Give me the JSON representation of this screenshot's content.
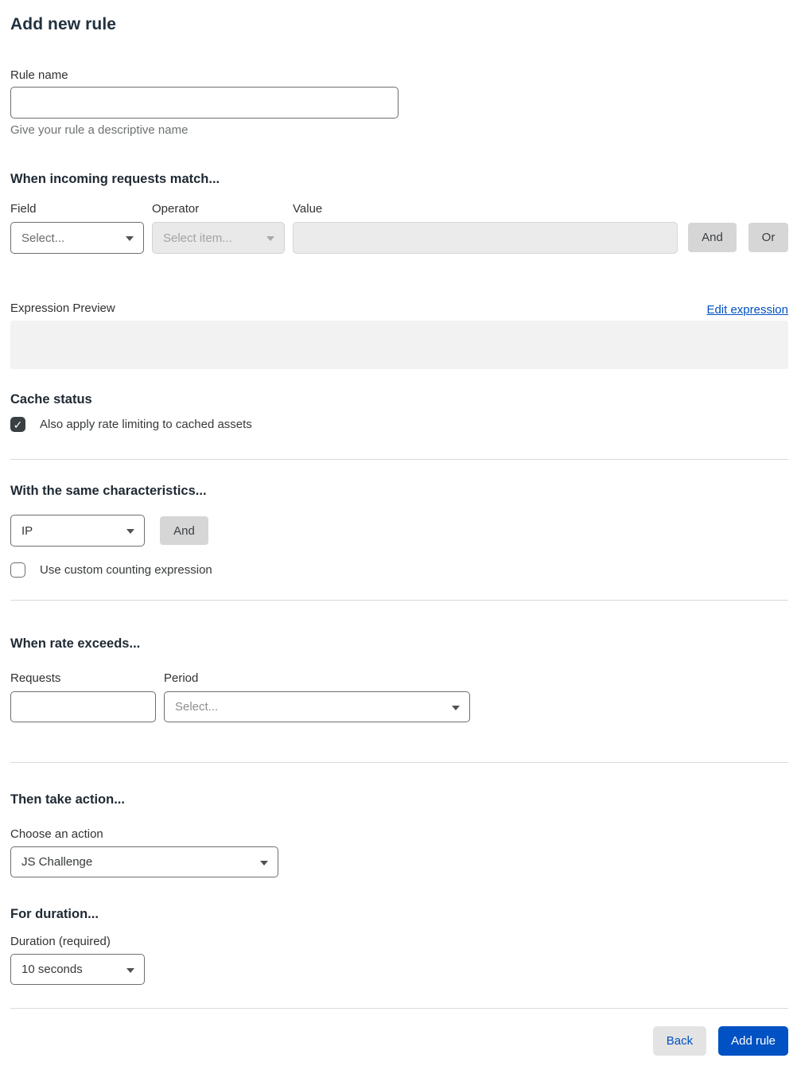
{
  "page": {
    "title": "Add new rule"
  },
  "rule_name": {
    "label": "Rule name",
    "value": "",
    "helper": "Give your rule a descriptive name"
  },
  "match": {
    "heading": "When incoming requests match...",
    "field_label": "Field",
    "field_value": "Select...",
    "operator_label": "Operator",
    "operator_value": "Select item...",
    "operator_disabled": true,
    "value_label": "Value",
    "value_value": "",
    "value_disabled": true,
    "and_button": "And",
    "or_button": "Or"
  },
  "expression": {
    "label": "Expression Preview",
    "edit_link": "Edit expression",
    "preview": ""
  },
  "cache": {
    "heading": "Cache status",
    "checkbox_label": "Also apply rate limiting to cached assets",
    "checked": true
  },
  "characteristics": {
    "heading": "With the same characteristics...",
    "select_value": "IP",
    "and_button": "And",
    "checkbox_label": "Use custom counting expression",
    "checked": false
  },
  "rate": {
    "heading": "When rate exceeds...",
    "requests_label": "Requests",
    "requests_value": "",
    "period_label": "Period",
    "period_value": "Select..."
  },
  "action": {
    "heading": "Then take action...",
    "label": "Choose an action",
    "value": "JS Challenge"
  },
  "duration": {
    "heading": "For duration...",
    "label": "Duration (required)",
    "value": "10 seconds"
  },
  "footer": {
    "back": "Back",
    "submit": "Add rule"
  },
  "icons": {
    "checkmark": "✓"
  },
  "colors": {
    "accent_blue": "#0051c3",
    "link_blue": "#0051c3",
    "chip_gray": "#d6d6d6",
    "disabled_bg": "#e9e9e9",
    "preview_bg": "#f2f2f2",
    "divider": "#d9d9d9",
    "checkbox_checked": "#3a3f42"
  }
}
